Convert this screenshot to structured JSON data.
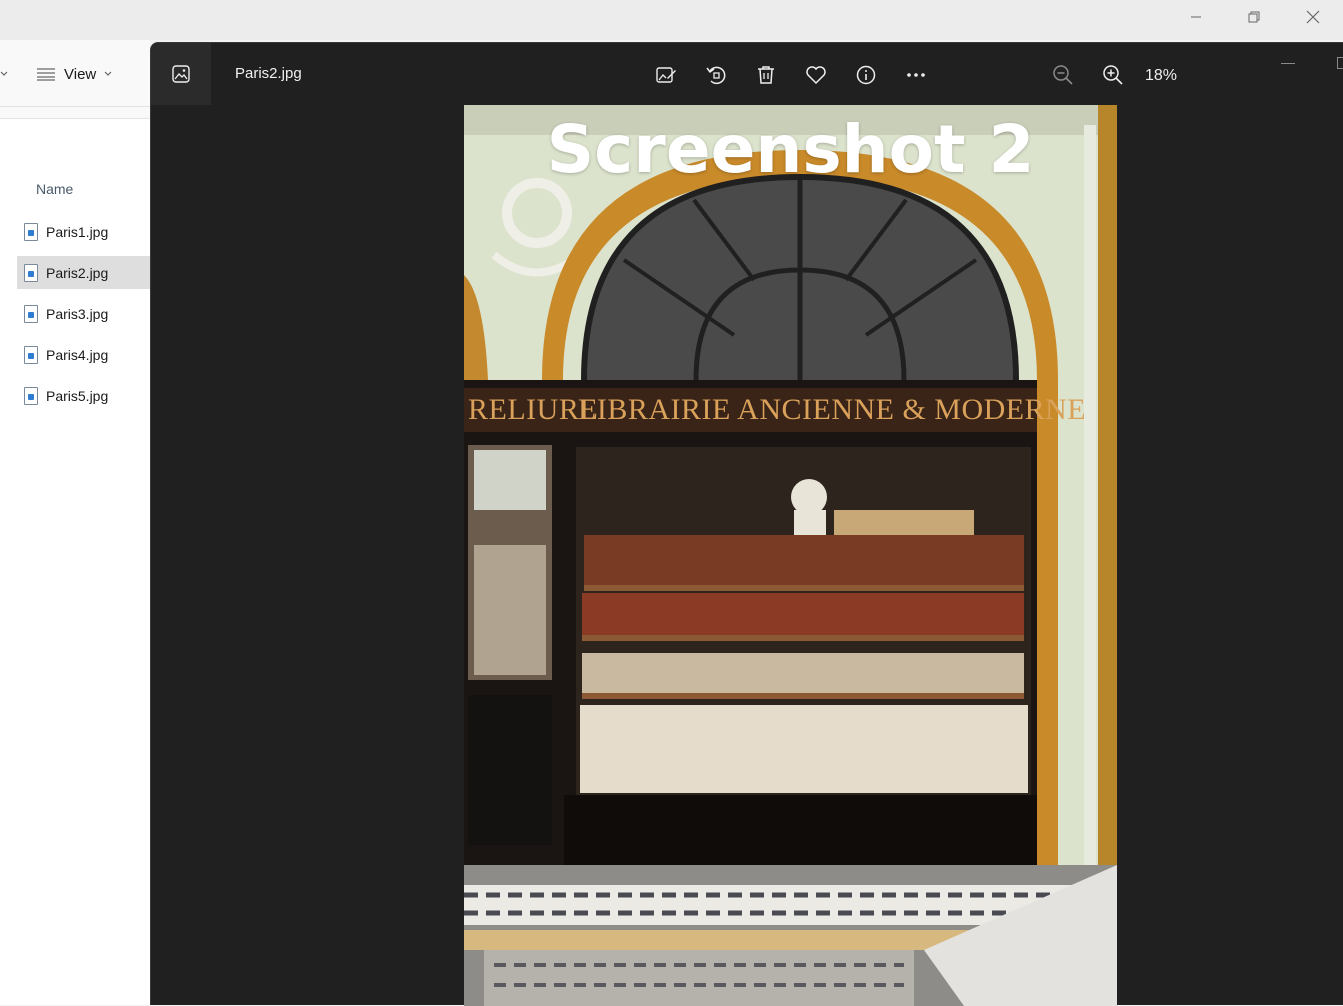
{
  "explorer": {
    "toolbar": {
      "view_label": "View"
    },
    "columns": {
      "name": "Name"
    },
    "files": [
      {
        "name": "Paris1.jpg",
        "selected": false
      },
      {
        "name": "Paris2.jpg",
        "selected": true
      },
      {
        "name": "Paris3.jpg",
        "selected": false
      },
      {
        "name": "Paris4.jpg",
        "selected": false
      },
      {
        "name": "Paris5.jpg",
        "selected": false
      }
    ]
  },
  "photos": {
    "title": "Paris2.jpg",
    "zoom": "18%",
    "toolbar_icons": [
      "edit-image-icon",
      "rotate-icon",
      "delete-icon",
      "favorite-icon",
      "info-icon",
      "more-icon"
    ],
    "image": {
      "overlay_text": "Screenshot 2",
      "sign_left": "RELIURE",
      "sign_main": "LIBRAIRIE ANCIENNE & MODERNE"
    }
  },
  "colors": {
    "viewer_bg": "#202020",
    "selection": "#dedede",
    "accent": "#2e7dd1"
  }
}
